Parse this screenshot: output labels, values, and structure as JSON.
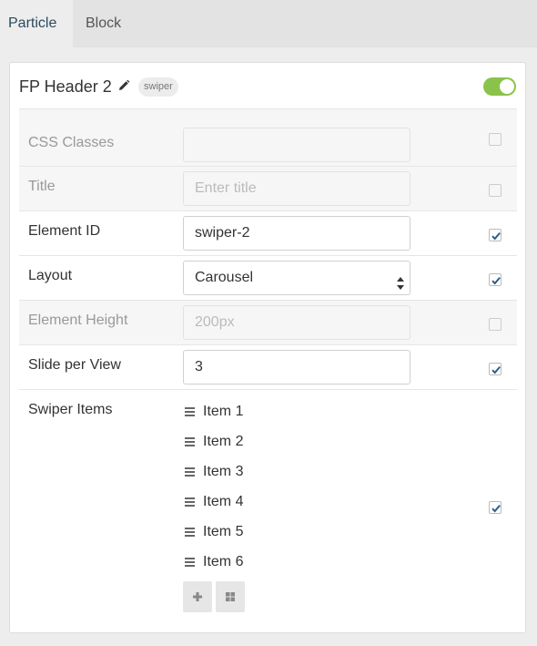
{
  "tabs": [
    {
      "label": "Particle",
      "active": true
    },
    {
      "label": "Block",
      "active": false
    }
  ],
  "header": {
    "title": "FP Header 2",
    "badge": "swiper",
    "enabled": true
  },
  "fields": {
    "css_classes": {
      "label": "CSS Classes",
      "value": "",
      "checked": false,
      "disabled": true
    },
    "title": {
      "label": "Title",
      "placeholder": "Enter title",
      "value": "",
      "checked": false,
      "disabled": true
    },
    "element_id": {
      "label": "Element ID",
      "value": "swiper-2",
      "checked": true,
      "disabled": false
    },
    "layout": {
      "label": "Layout",
      "value": "Carousel",
      "checked": true,
      "disabled": false
    },
    "element_height": {
      "label": "Element Height",
      "placeholder": "200px",
      "value": "",
      "checked": false,
      "disabled": true
    },
    "slide_per_view": {
      "label": "Slide per View",
      "value": "3",
      "checked": true,
      "disabled": false
    },
    "swiper_items": {
      "label": "Swiper Items",
      "checked": true,
      "items": [
        "Item 1",
        "Item 2",
        "Item 3",
        "Item 4",
        "Item 5",
        "Item 6"
      ]
    }
  },
  "colors": {
    "toggle_on": "#8bc34a",
    "check": "#2b5f8a",
    "tab_active_text": "#2b4a5e"
  }
}
